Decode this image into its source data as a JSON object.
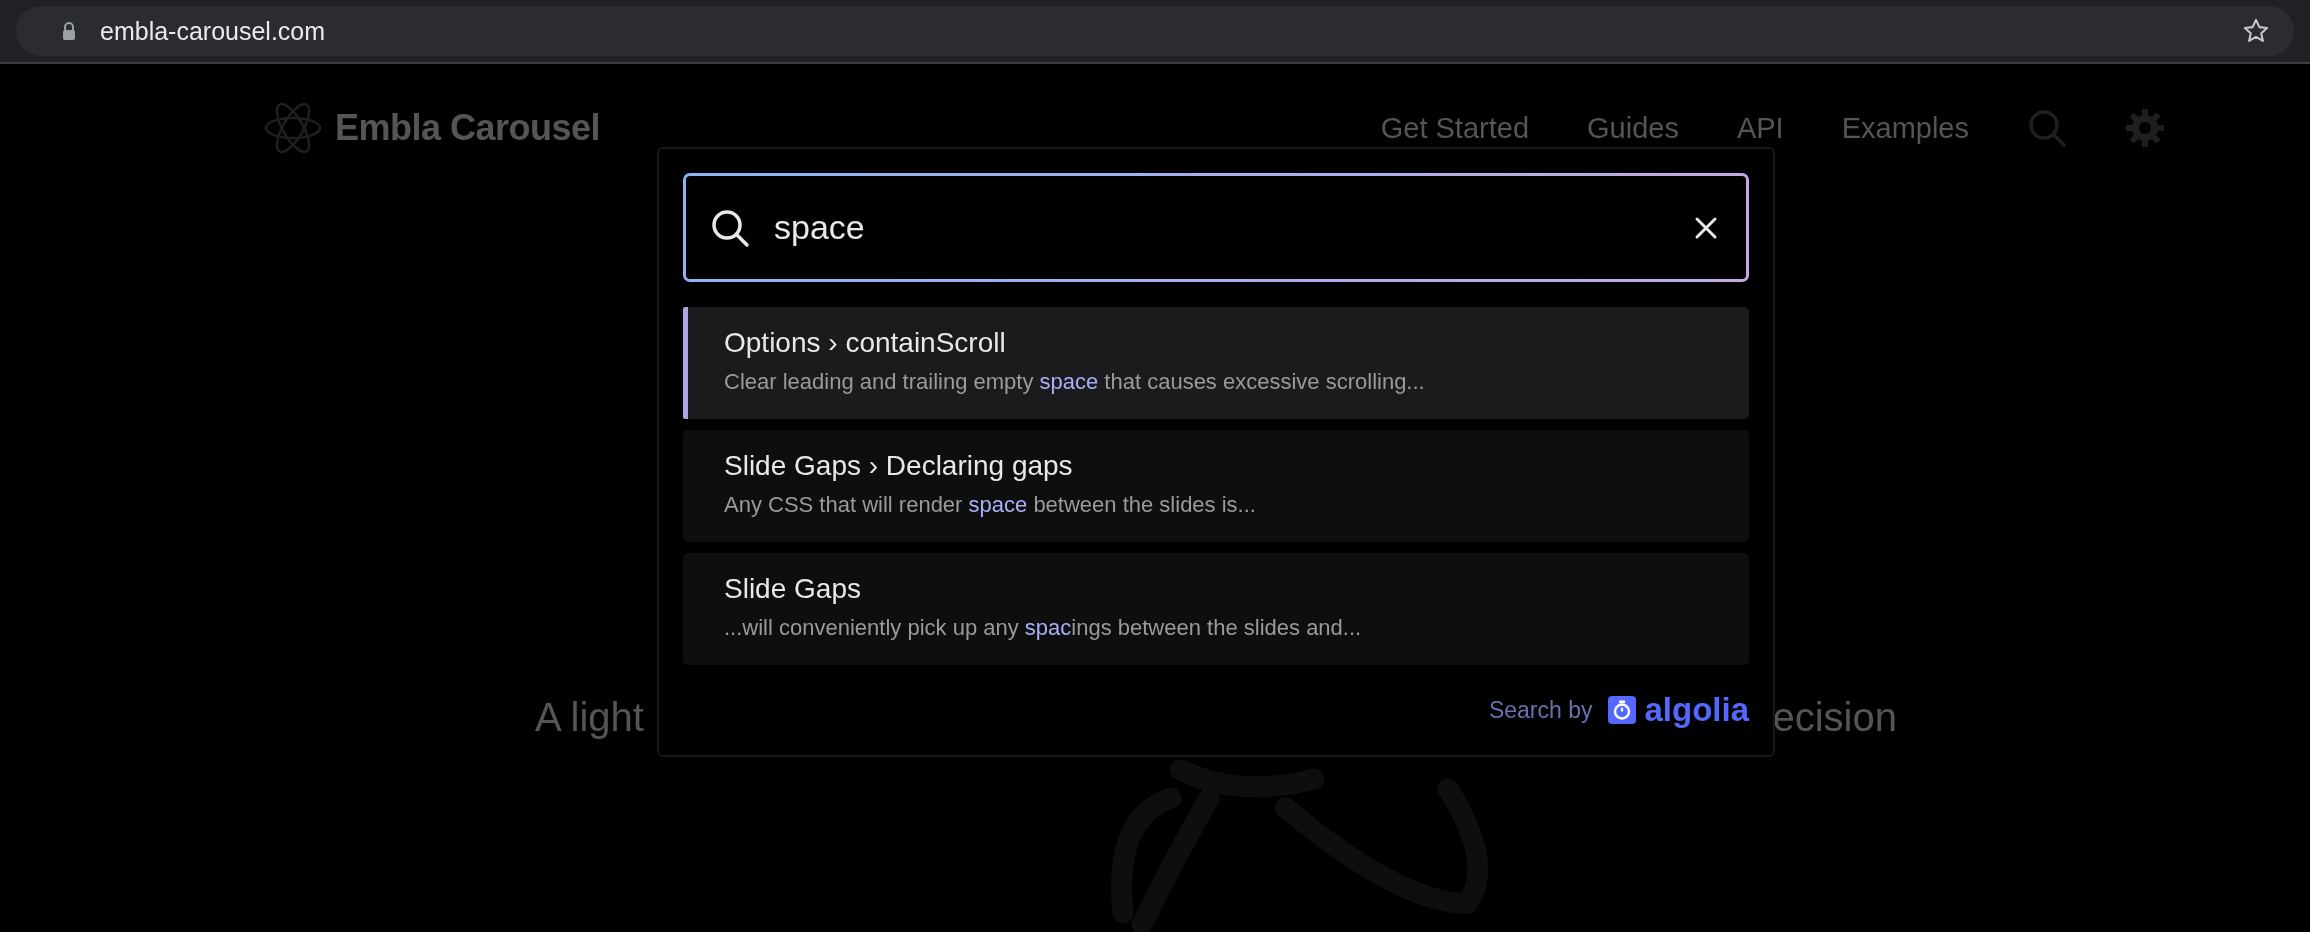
{
  "browser": {
    "url": "embla-carousel.com"
  },
  "header": {
    "logo": "Embla Carousel",
    "nav": [
      {
        "label": "Get Started"
      },
      {
        "label": "Guides"
      },
      {
        "label": "API"
      },
      {
        "label": "Examples"
      }
    ]
  },
  "hero": {
    "tagline_left": "A light",
    "tagline_right": "ecision"
  },
  "search": {
    "query": "space",
    "results": [
      {
        "title": "Options › containScroll",
        "snippet": "Clear leading and trailing empty **space** that causes excessive scrolling...",
        "selected": true
      },
      {
        "title": "Slide Gaps › Declaring gaps",
        "snippet": "Any CSS that will render **space** between the slides is...",
        "selected": false
      },
      {
        "title": "Slide Gaps",
        "snippet": "...will conveniently pick up any **spac**ings between the slides and...",
        "selected": false
      }
    ],
    "footer": {
      "label": "Search by",
      "brand": "algolia"
    }
  }
}
